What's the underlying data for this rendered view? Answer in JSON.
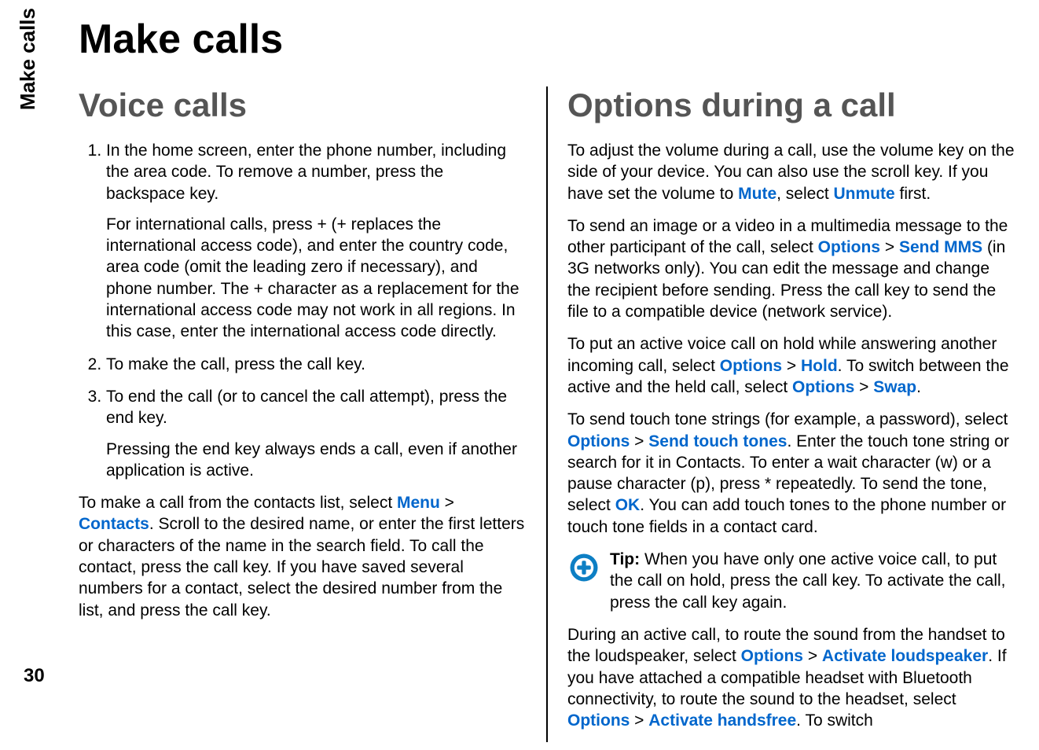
{
  "side_tab": "Make calls",
  "page_number": "30",
  "main_title": "Make calls",
  "left": {
    "heading": "Voice calls",
    "steps": [
      {
        "main": "In the home screen, enter the phone number, including the area code. To remove a number, press the backspace key.",
        "sub": "For international calls, press + (+ replaces the international access code), and enter the country code, area code (omit the leading zero if necessary), and phone number. The + character as a replacement for the international access code may not work in all regions. In this case, enter the international access code directly."
      },
      {
        "main": "To make the call, press the call key."
      },
      {
        "main": "To end the call (or to cancel the call attempt), press the end key.",
        "sub": "Pressing the end key always ends a call, even if another application is active."
      }
    ],
    "para_pre": "To make a call from the contacts list, select ",
    "kw_menu": "Menu",
    "para_mid1": " > ",
    "kw_contacts": "Contacts",
    "para_post": ". Scroll to the desired name, or enter the first letters or characters of the name in the search field. To call the contact, press the call key. If you have saved several numbers for a contact, select the desired number from the list, and press the call key."
  },
  "right": {
    "heading": "Options during a call",
    "p1_a": "To adjust the volume during a call, use the volume key on the side of your device. You can also use the scroll key. If you have set the volume to ",
    "kw_mute": "Mute",
    "p1_b": ", select ",
    "kw_unmute": "Unmute",
    "p1_c": " first.",
    "p2_a": "To send an image or a video in a multimedia message to the other participant of the call, select ",
    "kw_options1": "Options",
    "p2_b": " > ",
    "kw_sendmms": "Send MMS",
    "p2_c": " (in 3G networks only). You can edit the message and change the recipient before sending. Press the call key to send the file to a compatible device (network service).",
    "p3_a": "To put an active voice call on hold while answering another incoming call, select ",
    "kw_options2": "Options",
    "p3_b": " > ",
    "kw_hold": "Hold",
    "p3_c": ". To switch between the active and the held call, select ",
    "kw_options3": "Options",
    "p3_d": " > ",
    "kw_swap": "Swap",
    "p3_e": ".",
    "p4_a": "To send touch tone strings (for example, a password), select ",
    "kw_options4": "Options",
    "p4_b": " > ",
    "kw_sendtouch": "Send touch tones",
    "p4_c": ". Enter the touch tone string or search for it in Contacts. To enter a wait character (w) or a pause character (p), press * repeatedly. To send the tone, select ",
    "kw_ok": "OK",
    "p4_d": ". You can add touch tones to the phone number or touch tone fields in a contact card.",
    "tip_label": "Tip: ",
    "tip_text": "When you have only one active voice call, to put the call on hold, press the call key. To activate the call, press the call key again.",
    "p5_a": "During an active call, to route the sound from the handset to the loudspeaker, select ",
    "kw_options5": "Options",
    "p5_b": " > ",
    "kw_actloud": "Activate loudspeaker",
    "p5_c": ". If you have attached a compatible headset with Bluetooth connectivity, to route the sound to the headset, select ",
    "kw_options6": "Options",
    "p5_d": " > ",
    "kw_acthands": "Activate handsfree",
    "p5_e": ". To switch"
  }
}
